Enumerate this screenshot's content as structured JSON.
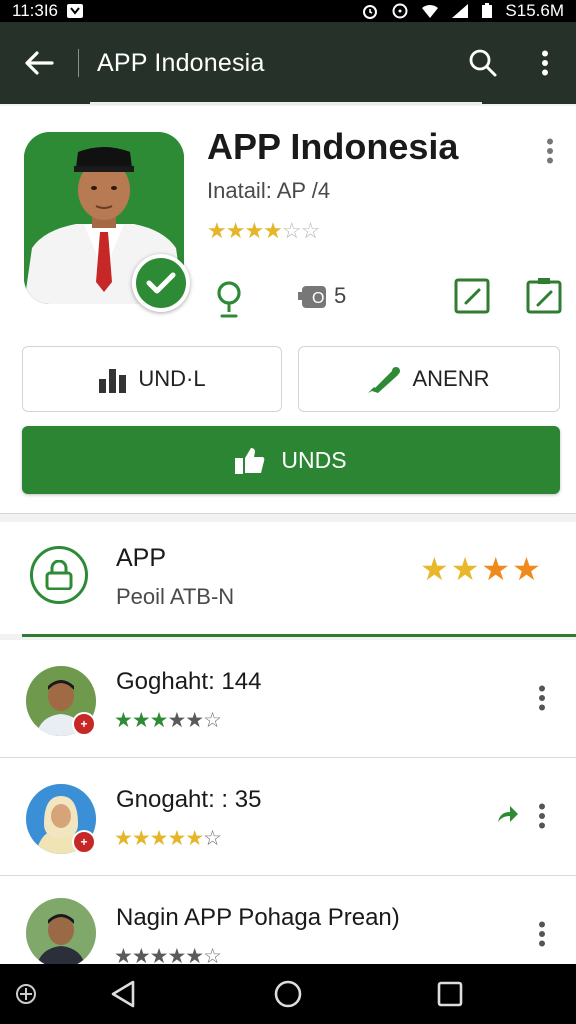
{
  "status_bar": {
    "time": "11:3I6",
    "right_text": "S15.6M"
  },
  "app_bar": {
    "title": "APP Indonesia"
  },
  "app": {
    "name": "APP Indonesia",
    "install_text": "Inatail: AP /4",
    "rating_stars": "★★★★☆☆",
    "downloads_suffix": "5",
    "downloads_glyph": "O",
    "buttons": {
      "left": "UND·L",
      "right": "ANENR",
      "primary": "UNDS"
    }
  },
  "section": {
    "title": "APP",
    "subtitle": "Peoil ATB-N",
    "stars": "★★★★"
  },
  "reviews": [
    {
      "name": "Goghaht: 144",
      "rating": 4,
      "stars_style": "green"
    },
    {
      "name": "Gnogaht: : 35",
      "rating": 4,
      "stars_style": "yellow"
    },
    {
      "name": "Nagin APP Pohaga Prean)",
      "rating": 5,
      "stars_style": "gray"
    }
  ],
  "review_star_strings": {
    "r0_filled": "★★★",
    "r0_dark": "★★",
    "r0_empty": "☆",
    "r1_filled": "★★★★★",
    "r1_empty": "☆",
    "r2_filled": "★★★★★",
    "r2_empty": "☆"
  },
  "colors": {
    "accent": "#2b8532",
    "appbar": "#263229",
    "star": "#e5b52a",
    "orange_star": "#f0a020"
  },
  "icons": [
    "back-arrow-icon",
    "search-icon",
    "overflow-menu-icon",
    "verified-check-icon",
    "location-pin-icon",
    "edit-icon",
    "bar-chart-icon",
    "pen-icon",
    "thumbs-up-icon",
    "lock-icon",
    "share-icon"
  ]
}
